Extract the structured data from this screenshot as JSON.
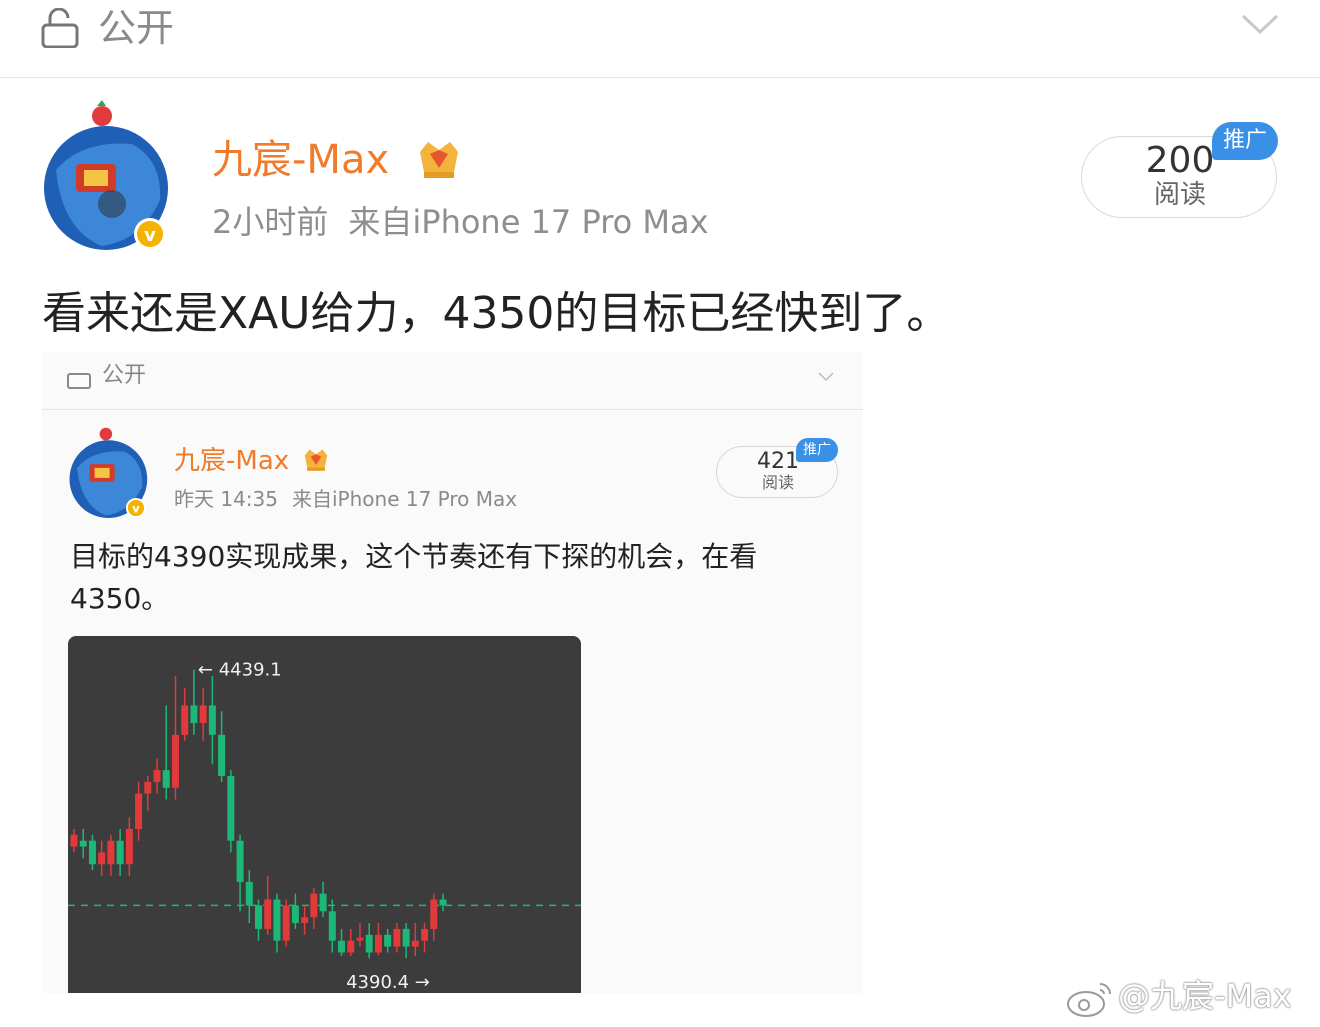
{
  "header": {
    "visibility_label": "公开"
  },
  "post": {
    "author": "九宸-Max",
    "time": "2小时前",
    "source": "来自iPhone 17 Pro Max",
    "views_count": "200",
    "views_label": "阅读",
    "promo_label": "推广",
    "text": "看来还是XAU给力，4350的目标已经快到了。"
  },
  "embedded": {
    "visibility_label": "公开",
    "author": "九宸-Max",
    "time": "昨天 14:35",
    "source": "来自iPhone 17 Pro Max",
    "views_count": "421",
    "views_label": "阅读",
    "promo_label": "推广",
    "text": "目标的4390实现成果，这个节奏还有下探的机会，在看4350。"
  },
  "chart_data": {
    "type": "candlestick",
    "high_label": "← 4439.1",
    "low_label": "4390.4 →",
    "high": 4439.1,
    "low": 4390.4,
    "reference_line_style": "dashed-green",
    "colors": {
      "up": "#e03a3a",
      "down": "#1db877",
      "background": "#3c3c3c"
    },
    "candles": [
      [
        4409,
        4411,
        4408,
        4412
      ],
      [
        4410,
        4409,
        4407,
        4412
      ],
      [
        4410,
        4406,
        4405,
        4411
      ],
      [
        4406,
        4408,
        4404,
        4410
      ],
      [
        4406,
        4410,
        4404,
        4411
      ],
      [
        4410,
        4406,
        4404,
        4412
      ],
      [
        4406,
        4412,
        4404,
        4414
      ],
      [
        4412,
        4418,
        4410,
        4420
      ],
      [
        4418,
        4420,
        4415,
        4421
      ],
      [
        4420,
        4422,
        4418,
        4424
      ],
      [
        4422,
        4419,
        4417,
        4433
      ],
      [
        4419,
        4428,
        4417,
        4438
      ],
      [
        4428,
        4433,
        4427,
        4436
      ],
      [
        4433,
        4430,
        4428,
        4439.1
      ],
      [
        4430,
        4433,
        4427,
        4436
      ],
      [
        4433,
        4428,
        4423,
        4438
      ],
      [
        4428,
        4421,
        4420,
        4432
      ],
      [
        4421,
        4410,
        4408,
        4422
      ],
      [
        4410,
        4403,
        4398,
        4411
      ],
      [
        4403,
        4399,
        4396,
        4405
      ],
      [
        4399,
        4395,
        4393,
        4400
      ],
      [
        4395,
        4400,
        4394,
        4404
      ],
      [
        4400,
        4393,
        4391,
        4401
      ],
      [
        4393,
        4399,
        4392,
        4400
      ],
      [
        4399,
        4396,
        4395,
        4401
      ],
      [
        4396,
        4397,
        4394,
        4399
      ],
      [
        4397,
        4401,
        4395,
        4402
      ],
      [
        4401,
        4398,
        4397,
        4403
      ],
      [
        4398,
        4393,
        4391,
        4400
      ],
      [
        4393,
        4391,
        4390.4,
        4395
      ],
      [
        4391,
        4393,
        4390.4,
        4395
      ],
      [
        4393,
        4393.5,
        4392,
        4396
      ],
      [
        4394,
        4391,
        4390,
        4396
      ],
      [
        4391,
        4394,
        4390.5,
        4396
      ],
      [
        4394,
        4392,
        4391,
        4395
      ],
      [
        4392,
        4395,
        4391,
        4396
      ],
      [
        4395,
        4392,
        4390,
        4396
      ],
      [
        4392,
        4393,
        4390.4,
        4396
      ],
      [
        4393,
        4395,
        4391,
        4396
      ],
      [
        4395,
        4400,
        4393,
        4401
      ],
      [
        4400,
        4399,
        4398,
        4401
      ]
    ]
  },
  "watermark": {
    "text": "@九宸-Max"
  }
}
